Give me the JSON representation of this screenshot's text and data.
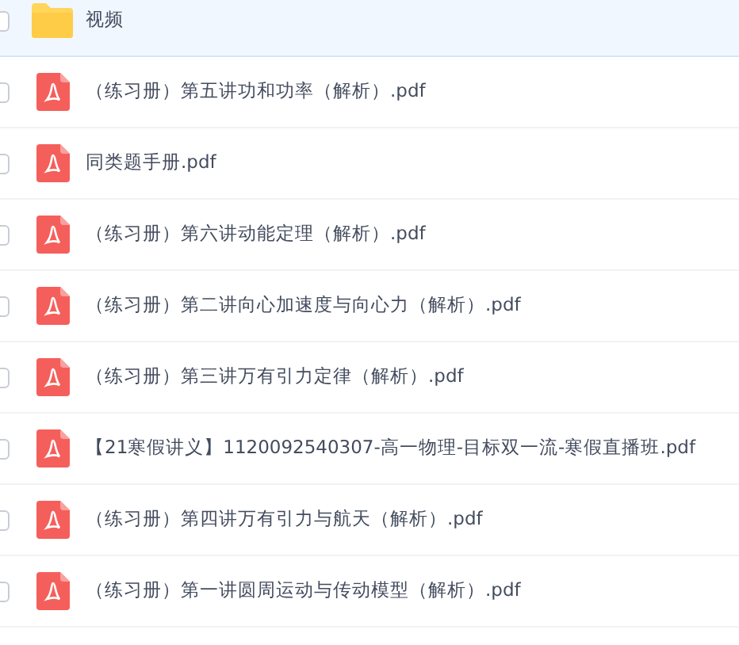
{
  "files": [
    {
      "kind": "folder",
      "name": "视频",
      "selected": true
    },
    {
      "kind": "pdf",
      "name": "（练习册）第五讲功和功率（解析）.pdf",
      "selected": false
    },
    {
      "kind": "pdf",
      "name": "同类题手册.pdf",
      "selected": false
    },
    {
      "kind": "pdf",
      "name": "（练习册）第六讲动能定理（解析）.pdf",
      "selected": false
    },
    {
      "kind": "pdf",
      "name": "（练习册）第二讲向心加速度与向心力（解析）.pdf",
      "selected": false
    },
    {
      "kind": "pdf",
      "name": "（练习册）第三讲万有引力定律（解析）.pdf",
      "selected": false
    },
    {
      "kind": "pdf",
      "name": "【21寒假讲义】1120092540307-高一物理-目标双一流-寒假直播班.pdf",
      "selected": false
    },
    {
      "kind": "pdf",
      "name": "（练习册）第四讲万有引力与航天（解析）.pdf",
      "selected": false
    },
    {
      "kind": "pdf",
      "name": "（练习册）第一讲圆周运动与传动模型（解析）.pdf",
      "selected": false
    }
  ]
}
